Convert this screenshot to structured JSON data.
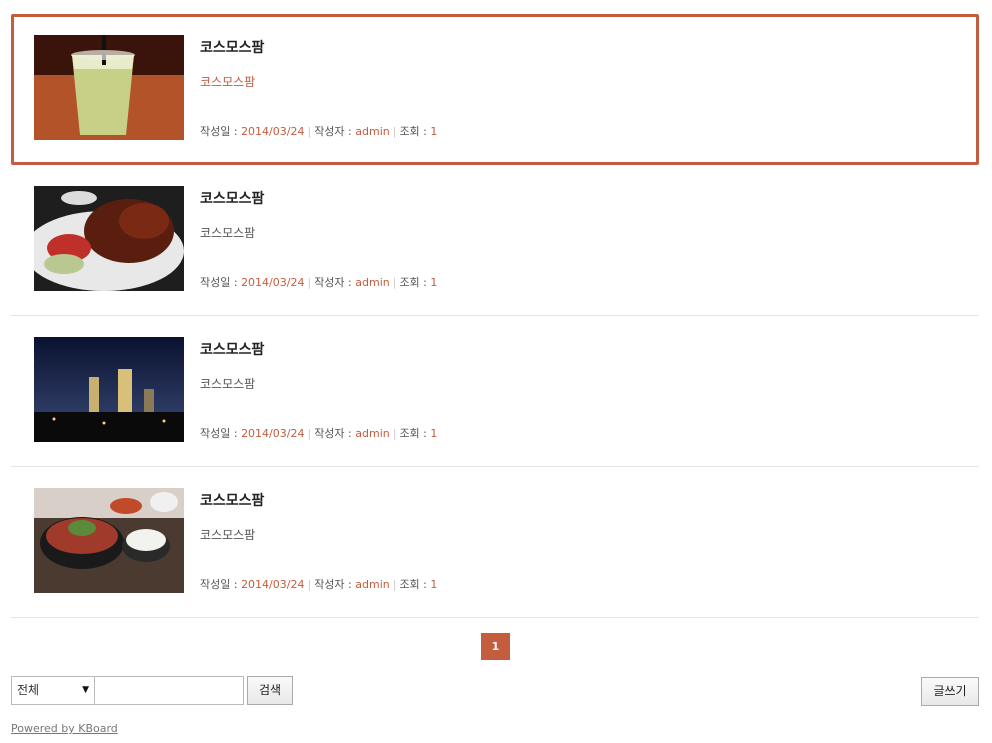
{
  "posts": [
    {
      "title": "코스모스팜",
      "summary": "코스모스팜",
      "date_label": "작성일 :",
      "date": "2014/03/24",
      "author_label": "작성자 :",
      "author": "admin",
      "views_label": "조회 :",
      "views": "1",
      "thumb": "kiwi-drink"
    },
    {
      "title": "코스모스팜",
      "summary": "코스모스팜",
      "date_label": "작성일 :",
      "date": "2014/03/24",
      "author_label": "작성자 :",
      "author": "admin",
      "views_label": "조회 :",
      "views": "1",
      "thumb": "fried-chicken"
    },
    {
      "title": "코스모스팜",
      "summary": "코스모스팜",
      "date_label": "작성일 :",
      "date": "2014/03/24",
      "author_label": "작성자 :",
      "author": "admin",
      "views_label": "조회 :",
      "views": "1",
      "thumb": "night-city"
    },
    {
      "title": "코스모스팜",
      "summary": "코스모스팜",
      "date_label": "작성일 :",
      "date": "2014/03/24",
      "author_label": "작성자 :",
      "author": "admin",
      "views_label": "조회 :",
      "views": "1",
      "thumb": "korean-meal"
    }
  ],
  "pagination": {
    "current": "1"
  },
  "search": {
    "select_value": "전체",
    "input_value": "",
    "button": "검색"
  },
  "write_button": "글쓰기",
  "footer": {
    "powered": "Powered by KBoard"
  },
  "colors": {
    "accent": "#c45c3e"
  }
}
